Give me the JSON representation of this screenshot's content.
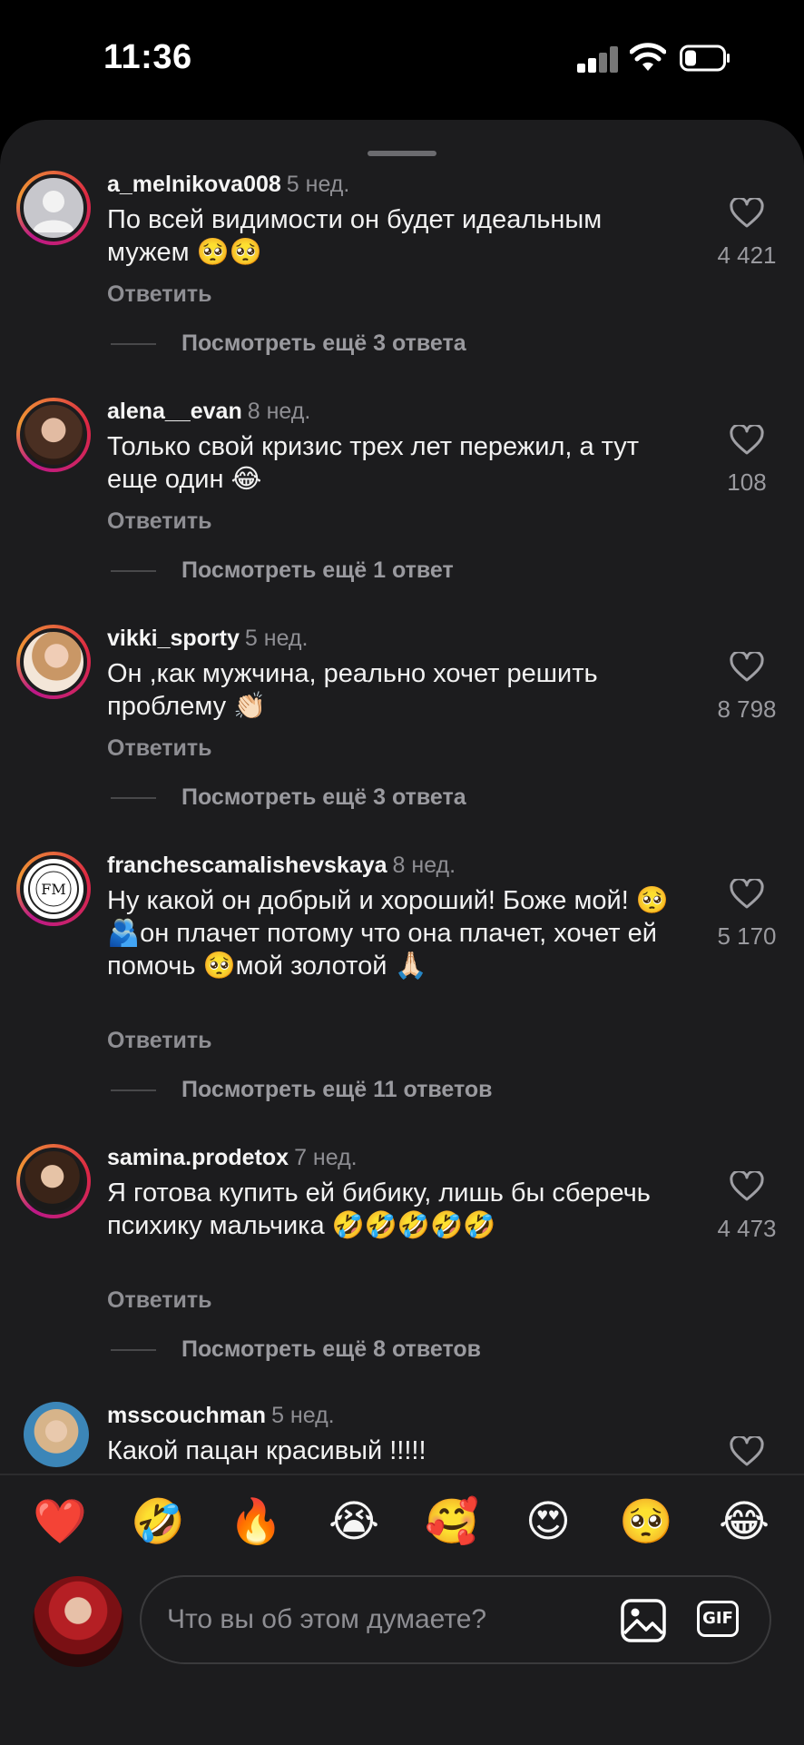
{
  "status_bar": {
    "time": "11:36"
  },
  "comments": [
    {
      "username": "a_melnikova008",
      "age": "5 нед.",
      "text": "По всей видимости он будет идеальным мужем 🥺🥺",
      "reply_label": "Ответить",
      "more_replies": "Посмотреть ещё 3 ответа",
      "likes": "4 421",
      "avatar": "default-avatar"
    },
    {
      "username": "alena__evan",
      "age": "8 нед.",
      "text": "Только свой кризис трех лет пережил, а тут еще один 😂",
      "reply_label": "Ответить",
      "more_replies": "Посмотреть ещё 1 ответ",
      "likes": "108",
      "avatar": "photo-avatar"
    },
    {
      "username": "vikki_sporty",
      "age": "5 нед.",
      "text": "Он ,как мужчина, реально хочет решить проблему 👏🏻",
      "reply_label": "Ответить",
      "more_replies": "Посмотреть ещё 3 ответа",
      "likes": "8 798",
      "avatar": "photo-avatar"
    },
    {
      "username": "franchescamalishevskaya",
      "age": "8 нед.",
      "text": "Ну какой он добрый и хороший! Боже мой! 🥺🫂он плачет потому что она плачет, хочет ей помочь 🥺мой золотой 🙏🏻",
      "reply_label": "Ответить",
      "more_replies": "Посмотреть ещё 11 ответов",
      "likes": "5 170",
      "avatar": "logo-avatar",
      "avatar_logo_text": "FM"
    },
    {
      "username": "samina.prodetox",
      "age": "7 нед.",
      "text": "Я готова купить ей бибику, лишь бы сберечь психику мальчика 🤣🤣🤣🤣🤣",
      "reply_label": "Ответить",
      "more_replies": "Посмотреть ещё 8 ответов",
      "likes": "4 473",
      "avatar": "photo-avatar"
    },
    {
      "username": "msscouchman",
      "age": "5 нед.",
      "text": "Какой пацан красивый !!!!!",
      "likes": "",
      "avatar": "photo-avatar"
    }
  ],
  "reactions": [
    "❤️",
    "🤣",
    "🔥",
    "😭",
    "🥰",
    "😍",
    "🥺",
    "😂"
  ],
  "input": {
    "placeholder": "Что вы об этом думаете?",
    "gif_label": "GIF"
  },
  "colors": {
    "sheet_bg": "#1c1c1e",
    "secondary_text": "#8e8e93",
    "story_ring": "#dc2743"
  }
}
